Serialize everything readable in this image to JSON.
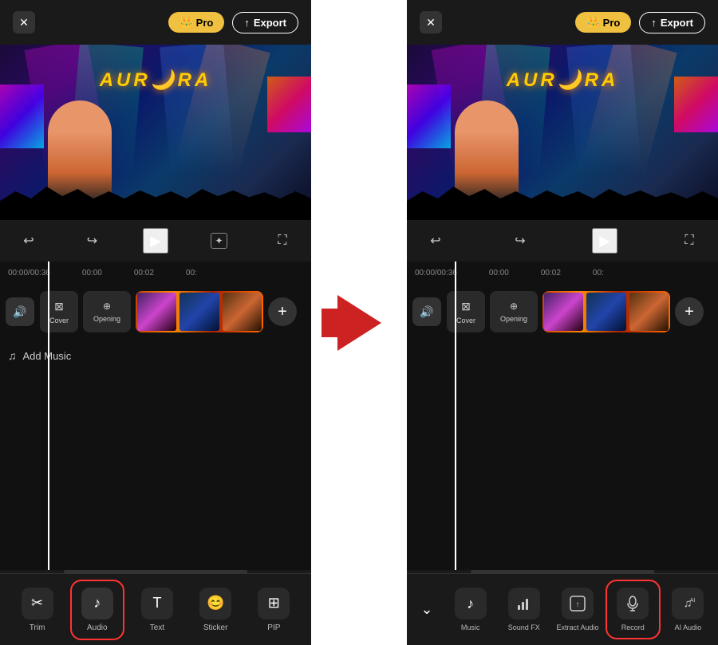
{
  "left_panel": {
    "header": {
      "close_label": "✕",
      "pro_label": "Pro",
      "export_label": "Export",
      "crown": "👑"
    },
    "controls": {
      "undo_icon": "↩",
      "redo_icon": "↪",
      "play_icon": "▶",
      "magic_icon": "✦",
      "fullscreen_icon": "⛶"
    },
    "timeline": {
      "current_time": "00:00",
      "total_time": "00:36",
      "markers": [
        "00:00",
        "00:02",
        "00:"
      ]
    },
    "tracks": {
      "cover_label": "Cover",
      "opening_label": "Opening",
      "add_music_label": "Add Music",
      "add_icon": "+"
    },
    "toolbar": {
      "items": [
        {
          "id": "trim",
          "icon": "✂",
          "label": "Trim"
        },
        {
          "id": "audio",
          "icon": "♪",
          "label": "Audio",
          "highlighted": true
        },
        {
          "id": "text",
          "icon": "T",
          "label": "Text"
        },
        {
          "id": "sticker",
          "icon": "●",
          "label": "Sticker"
        },
        {
          "id": "pip",
          "icon": "⊞",
          "label": "PIP"
        }
      ]
    }
  },
  "right_panel": {
    "header": {
      "close_label": "✕",
      "pro_label": "Pro",
      "export_label": "Export",
      "crown": "👑"
    },
    "controls": {
      "undo_icon": "↩",
      "redo_icon": "↪",
      "play_icon": "▶",
      "fullscreen_icon": "⛶"
    },
    "timeline": {
      "current_time": "00:00",
      "total_time": "00:36",
      "markers": [
        "00:00",
        "00:02",
        "00:"
      ]
    },
    "tracks": {
      "cover_label": "Cover",
      "opening_label": "Opening",
      "add_icon": "+"
    },
    "submenu": {
      "back_icon": "⌄",
      "items": [
        {
          "id": "music",
          "icon": "♪",
          "label": "Music"
        },
        {
          "id": "sound-fx",
          "icon": "📊",
          "label": "Sound FX"
        },
        {
          "id": "extract-audio",
          "icon": "⊞",
          "label": "Extract Audio"
        },
        {
          "id": "record",
          "icon": "🎤",
          "label": "Record",
          "highlighted": true
        },
        {
          "id": "ai-audio",
          "icon": "♫",
          "label": "AI Audio"
        }
      ]
    }
  },
  "arrow": {
    "direction": "right"
  }
}
